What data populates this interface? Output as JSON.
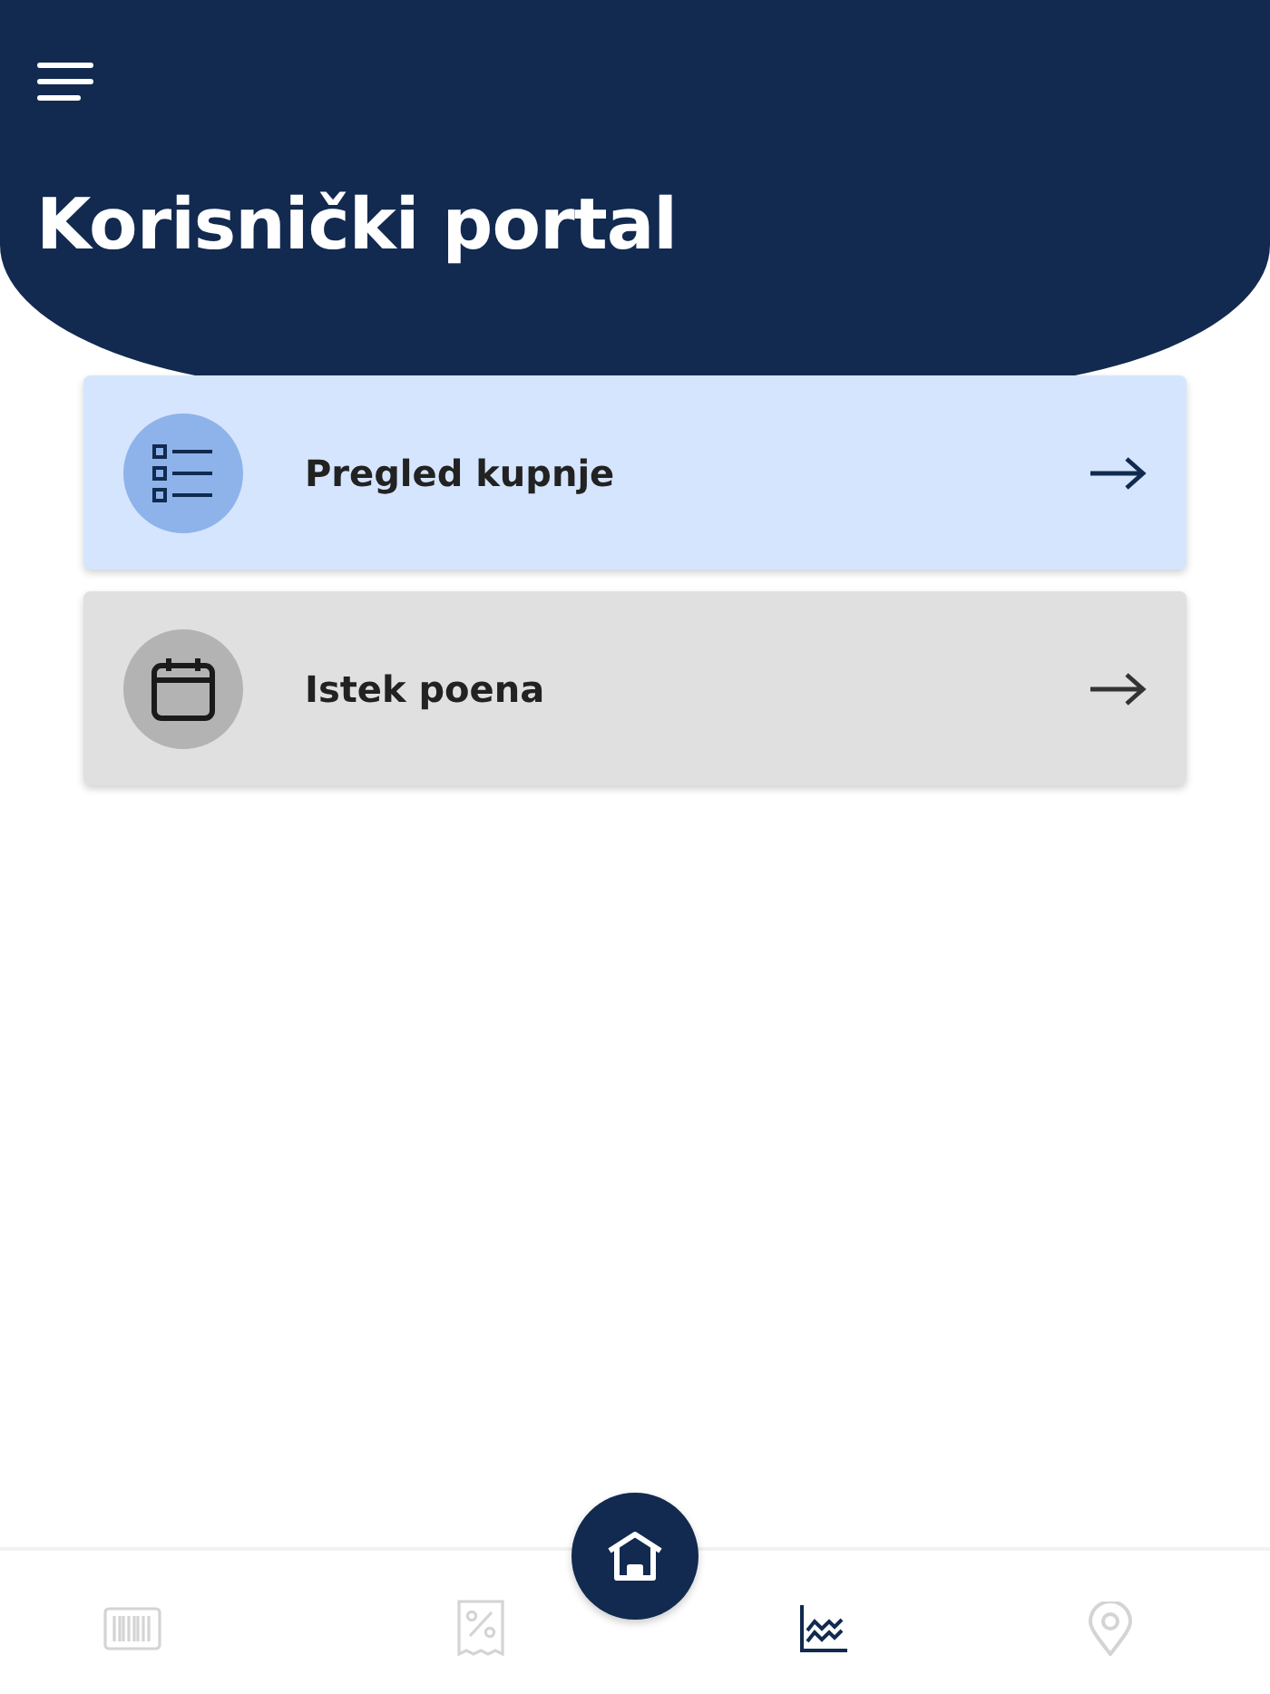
{
  "header": {
    "title": "Korisnički portal"
  },
  "cards": [
    {
      "label": "Pregled kupnje",
      "kind": "list",
      "selected": true
    },
    {
      "label": "Istek poena",
      "kind": "calendar",
      "selected": false
    }
  ],
  "bottom_nav": {
    "items": [
      {
        "kind": "barcode",
        "selected": false
      },
      {
        "kind": "receipt",
        "selected": false
      },
      {
        "kind": "chart",
        "selected": true
      },
      {
        "kind": "pin",
        "selected": false
      }
    ]
  }
}
